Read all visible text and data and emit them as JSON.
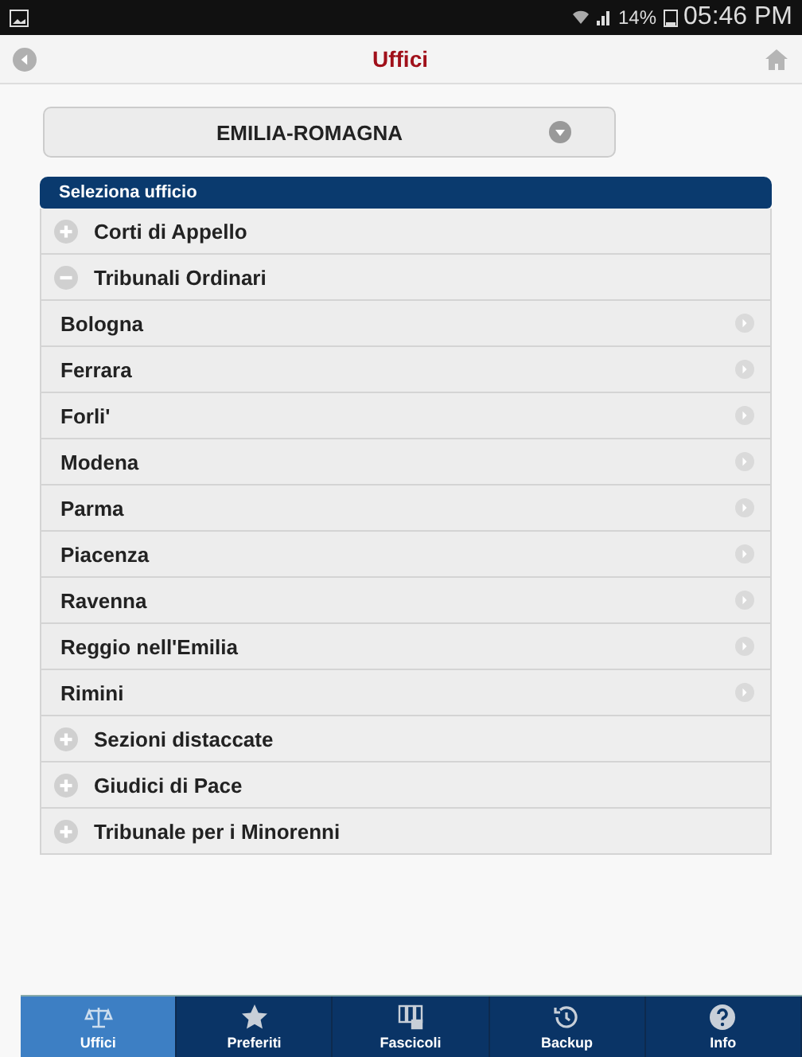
{
  "status_bar": {
    "battery": "14%",
    "time": "05:46 PM"
  },
  "header": {
    "title": "Uffici"
  },
  "region_select": {
    "value": "EMILIA-ROMAGNA"
  },
  "list": {
    "heading": "Seleziona ufficio",
    "groups": [
      {
        "label": "Corti di Appello",
        "expanded": false
      },
      {
        "label": "Tribunali Ordinari",
        "expanded": true,
        "children": [
          {
            "label": "Bologna"
          },
          {
            "label": "Ferrara"
          },
          {
            "label": "Forli'"
          },
          {
            "label": "Modena"
          },
          {
            "label": "Parma"
          },
          {
            "label": "Piacenza"
          },
          {
            "label": "Ravenna"
          },
          {
            "label": "Reggio nell'Emilia"
          },
          {
            "label": "Rimini"
          }
        ]
      },
      {
        "label": "Sezioni distaccate",
        "expanded": false
      },
      {
        "label": "Giudici di Pace",
        "expanded": false
      },
      {
        "label": "Tribunale per i Minorenni",
        "expanded": false
      }
    ]
  },
  "tab_bar": [
    {
      "label": "Uffici",
      "kind": "scales",
      "selected": true
    },
    {
      "label": "Preferiti",
      "kind": "star",
      "selected": false
    },
    {
      "label": "Fascicoli",
      "kind": "folders",
      "selected": false
    },
    {
      "label": "Backup",
      "kind": "history",
      "selected": false
    },
    {
      "label": "Info",
      "kind": "help",
      "selected": false
    }
  ]
}
